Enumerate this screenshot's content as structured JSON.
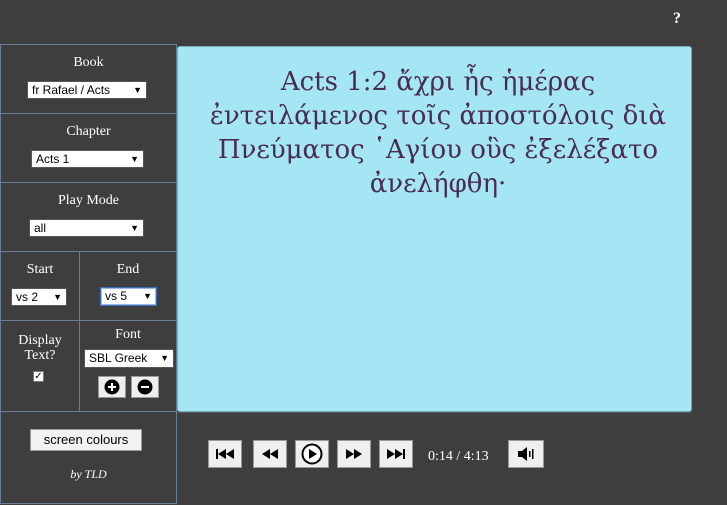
{
  "header": {
    "help_label": "?"
  },
  "sidebar": {
    "book": {
      "label": "Book",
      "value": "fr Rafael / Acts"
    },
    "chapter": {
      "label": "Chapter",
      "value": "Acts 1"
    },
    "play_mode": {
      "label": "Play Mode",
      "value": "all"
    },
    "start": {
      "label": "Start",
      "value": "vs 2"
    },
    "end": {
      "label": "End",
      "value": "vs 5"
    },
    "display_text": {
      "label_line1": "Display",
      "label_line2": "Text?",
      "checked": true,
      "check_mark": "✓"
    },
    "font": {
      "label": "Font",
      "value": "SBL Greek"
    },
    "screen_colours_label": "screen colours",
    "credit": "by TLD"
  },
  "reader": {
    "verse_text": "Acts 1:2 ἄχρι ἧς ἡμέρας ἐντειλάμενος τοῖς ἀποστόλοις διὰ Πνεύματος ῾Αγίου οὓς ἐξελέξατο ἀνελήφθη·"
  },
  "player": {
    "time": "0:14 / 4:13",
    "buttons": [
      "skip-start-icon",
      "rewind-icon",
      "play-icon",
      "fast-forward-icon",
      "skip-end-icon",
      "volume-icon"
    ]
  },
  "colors": {
    "text_panel": "#a4e6f3",
    "verse_text": "#4a2c4f",
    "background": "#3e3e3e"
  }
}
